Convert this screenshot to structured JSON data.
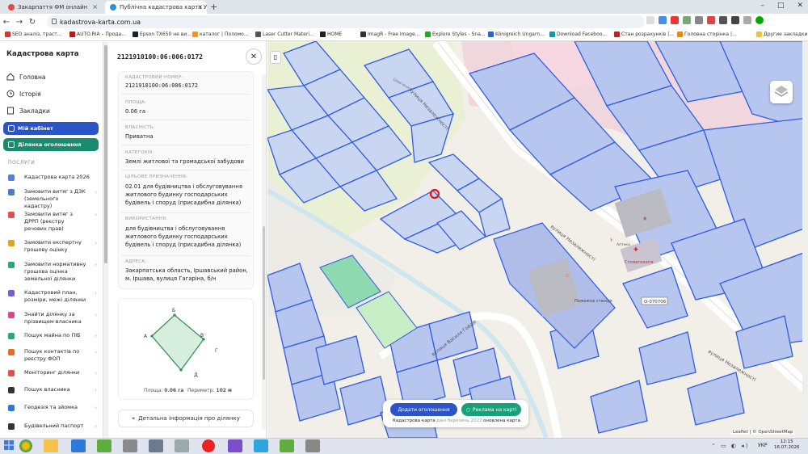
{
  "browser": {
    "tabs": [
      {
        "label": "Закарпаття ФМ онлайн"
      },
      {
        "label": "Публічна кадастрова карта Укр"
      }
    ],
    "url": "kadastrova-karta.com.ua",
    "bookmarks": [
      "SEO аналіз, траст...",
      "AUTO.RIA – Прода...",
      "Epson TX650 не ви...",
      "каталог | Поломо...",
      "Laser Cutter Materi...",
      "HOME",
      "ImagR - Free Image...",
      "Explore Styles - Sna...",
      "Königreich Ungarn...",
      "Download Faceboo...",
      "Стан розрахунків |...",
      "Головна сторінка |...",
      "Другие закладки"
    ]
  },
  "sidebar": {
    "brand": "Кадастрова карта",
    "nav": [
      {
        "label": "Головна",
        "icon": "home-icon"
      },
      {
        "label": "Історія",
        "icon": "clock-icon"
      },
      {
        "label": "Закладки",
        "icon": "bookmark-icon"
      }
    ],
    "cabinet_label": "Мій кабінет",
    "ads_label": "Ділянка оголошення",
    "services_header": "ПОСЛУГИ",
    "services": [
      {
        "label": "Кадастрова карта 2026",
        "icon": "layers-icon"
      },
      {
        "label": "Замовити витяг з ДЗК (земельного кадастру)",
        "icon": "document-icon"
      },
      {
        "label": "Замовити витяг з ДРРП (реєстру речових прав)",
        "icon": "document-icon"
      },
      {
        "label": "Замовити експертну грошову оцінку",
        "icon": "coins-icon"
      },
      {
        "label": "Замовити нормативну грошова оцінка земельної ділянки",
        "icon": "money-icon"
      },
      {
        "label": "Кадастровий план, розміри, межі ділянки",
        "icon": "ruler-icon"
      },
      {
        "label": "Знайти ділянку за прізвищем власника",
        "icon": "user-search-icon"
      },
      {
        "label": "Пошук майна по ПІБ",
        "icon": "search-icon"
      },
      {
        "label": "Пошук контактів по реєстру ФОП",
        "icon": "contacts-icon"
      },
      {
        "label": "Моніторинг ділянки",
        "icon": "bell-icon"
      },
      {
        "label": "Пошук власника",
        "icon": "car-icon"
      },
      {
        "label": "Геодезія та зйомка",
        "icon": "compass-icon"
      },
      {
        "label": "Будівельний паспорт",
        "icon": "passport-icon"
      }
    ]
  },
  "parcel": {
    "title": "2121910100:06:006:0172",
    "cadastral_label": "КАДАСТРОВИЙ НОМЕР:",
    "cadastral_value": "2121910100:06:006:0172",
    "area_label": "ПЛОЩА:",
    "area_value": "0.06 га",
    "ownership_label": "ВЛАСНІСТЬ:",
    "ownership_value": "Приватна",
    "category_label": "КАТЕГОРІЯ:",
    "category_value": "Землі житлової та громадської забудови",
    "purpose_label": "ЦІЛЬОВЕ ПРИЗНАЧЕННЯ:",
    "purpose_value": "02.01 для будівництва і обслуговування житлового будинку господарських будівель і споруд (присадибна ділянка)",
    "usage_label": "ВИКОРИСТАННЯ:",
    "usage_value": "для будівництва і обслуговування житлового будинку господарських будівель і споруд (присадибна ділянка)",
    "address_label": "АДРЕСА:",
    "address_value": "Закарпатська область, Іршавський район, м. Іршава, вулиця Гагаріна, б/н",
    "vertices": [
      "А",
      "Б",
      "В",
      "Г",
      "Д"
    ],
    "area_caption": "Площа:",
    "area_short": "0.06 га",
    "perimeter_caption": "Периметр:",
    "perimeter_value": "102 м",
    "details_button": "Детальна інформація про ділянку"
  },
  "map": {
    "street_labels": [
      "вулиця Незалежності",
      "вулиця Незалежності",
      "вулиця Незалежності",
      "вулиця Василя Гойди",
      "Шевченка"
    ],
    "road_code": "О-070706",
    "poi_labels": [
      "Пожежна станція",
      "Стоматологія",
      "Аптека"
    ],
    "attribution": "Leaflet | © OpenStreetMap",
    "add_ad_button": "Додати оголошення",
    "ad_on_map_button": "Реклама на карті",
    "update_label": "Кадастрова карта",
    "update_date": "дані березень 2022",
    "update_note": "оновлена карта"
  },
  "taskbar": {
    "language": "УКР",
    "time": "12:15",
    "date": "16.07.2026"
  }
}
